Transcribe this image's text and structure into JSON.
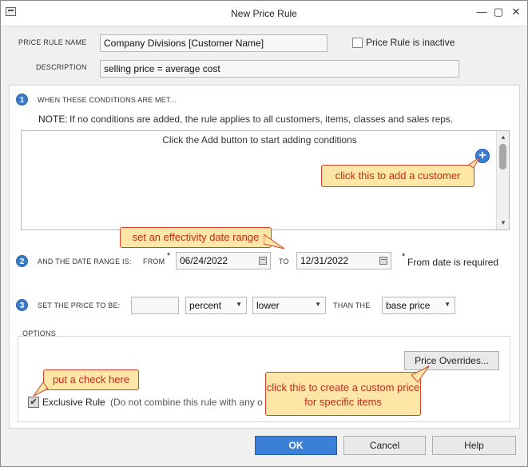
{
  "window": {
    "title": "New Price Rule",
    "minimize": "—",
    "restore": "▢",
    "close": "✕"
  },
  "header": {
    "rule_name_label": "PRICE RULE NAME",
    "rule_name_value": "Company Divisions [Customer Name]",
    "inactive_label": "Price Rule is inactive",
    "description_label": "DESCRIPTION",
    "description_value": "selling price = average cost"
  },
  "step1": {
    "number": "1",
    "heading": "WHEN THESE CONDITIONS ARE MET...",
    "note_label": "NOTE:",
    "note_text": "If no conditions are added, the rule applies to all customers, items, classes and sales reps.",
    "empty_text": "Click the Add button to start adding conditions",
    "add_symbol": "+"
  },
  "step2": {
    "number": "2",
    "label": "AND THE DATE RANGE IS:",
    "from_label": "FROM",
    "required_mark": "*",
    "from_date": "06/24/2022",
    "to_label": "TO",
    "to_date": "12/31/2022",
    "required_note_mark": "*",
    "required_note": "From date is required"
  },
  "step3": {
    "number": "3",
    "label": "SET THE PRICE TO BE:",
    "amount_value": "",
    "unit_value": "percent",
    "direction_value": "lower",
    "than_label": "THAN THE",
    "base_value": "base price"
  },
  "options": {
    "heading": "OPTIONS",
    "price_overrides_label": "Price Overrides...",
    "exclusive_label": "Exclusive Rule",
    "exclusive_desc": "(Do not combine this rule with any o",
    "exclusive_checked": true
  },
  "callouts": {
    "add_customer": "click this to add a customer",
    "date_range": "set an effectivity date range",
    "check_here": "put a check here",
    "custom_price": "click this to create a custom price for specific items"
  },
  "footer": {
    "ok_label": "OK",
    "cancel_label": "Cancel",
    "help_label": "Help"
  },
  "colors": {
    "accent": "#3c7fd6",
    "callout_bg": "#fde6a6",
    "callout_border": "#d9402c",
    "callout_text": "#c62a1b"
  }
}
